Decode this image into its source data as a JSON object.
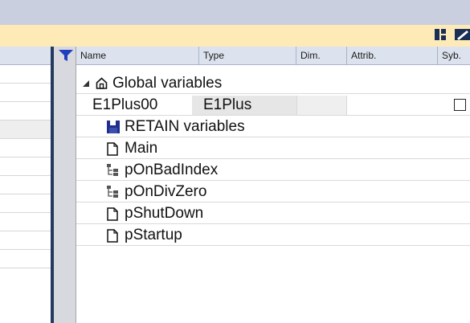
{
  "grid": {
    "columns": [
      "Name",
      "Type",
      "Dim.",
      "Attrib.",
      "Syb."
    ]
  },
  "tree": {
    "root_label": "Global variables",
    "instance_name": "E1Plus00",
    "instance_type": "E1Plus",
    "items": [
      {
        "label": "RETAIN variables",
        "icon": "save-icon"
      },
      {
        "label": "Main",
        "icon": "document-icon"
      },
      {
        "label": "pOnBadIndex",
        "icon": "hierarchy-icon"
      },
      {
        "label": "pOnDivZero",
        "icon": "hierarchy-icon"
      },
      {
        "label": "pShutDown",
        "icon": "document-icon"
      },
      {
        "label": "pStartup",
        "icon": "document-icon"
      }
    ]
  },
  "colors": {
    "title_band": "#fdeab6",
    "top_band": "#c9cfdf",
    "divider": "#243a5e",
    "accent": "#1f3fbf"
  }
}
